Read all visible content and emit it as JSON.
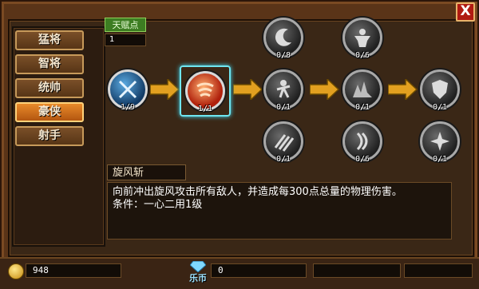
{
  "window": {
    "close_label": "X"
  },
  "tabs": [
    {
      "label": "猛将",
      "active": false
    },
    {
      "label": "智将",
      "active": false
    },
    {
      "label": "统帅",
      "active": false
    },
    {
      "label": "豪侠",
      "active": true
    },
    {
      "label": "射手",
      "active": false
    }
  ],
  "talent_points": {
    "label": "天赋点",
    "value": "1"
  },
  "skills": {
    "row1": [
      {
        "count": "1/9",
        "icon": "crossed-swords-icon"
      },
      {
        "count": "1/1",
        "icon": "whirlwind-icon",
        "selected": true
      },
      {
        "count": "0/1",
        "icon": "runner-icon"
      },
      {
        "count": "0/1",
        "icon": "rock-spikes-icon"
      },
      {
        "count": "0/1",
        "icon": "shield-icon"
      }
    ],
    "row0": [
      {
        "count": "0/8",
        "icon": "crescent-slash-icon"
      },
      {
        "count": "0/6",
        "icon": "strongman-icon"
      }
    ],
    "row2": [
      {
        "count": "0/1",
        "icon": "claw-icon"
      },
      {
        "count": "0/6",
        "icon": "wind-blade-icon"
      },
      {
        "count": "0/1",
        "icon": "shuriken-icon"
      }
    ]
  },
  "selected_skill": {
    "name": "旋风斩",
    "description": "向前冲出旋风攻击所有敌人，并造成每300点总量的物理伤害。",
    "condition": "条件：一心二用1级"
  },
  "currency": {
    "gold": "948",
    "lebi_label": "乐币",
    "lebi": "0"
  },
  "colors": {
    "frame": "#5a3418",
    "active_tab": "#e88a2a",
    "talent_green": "#3d7d22",
    "selected_glow": "#6fe6f0",
    "close_red": "#b01a12"
  }
}
